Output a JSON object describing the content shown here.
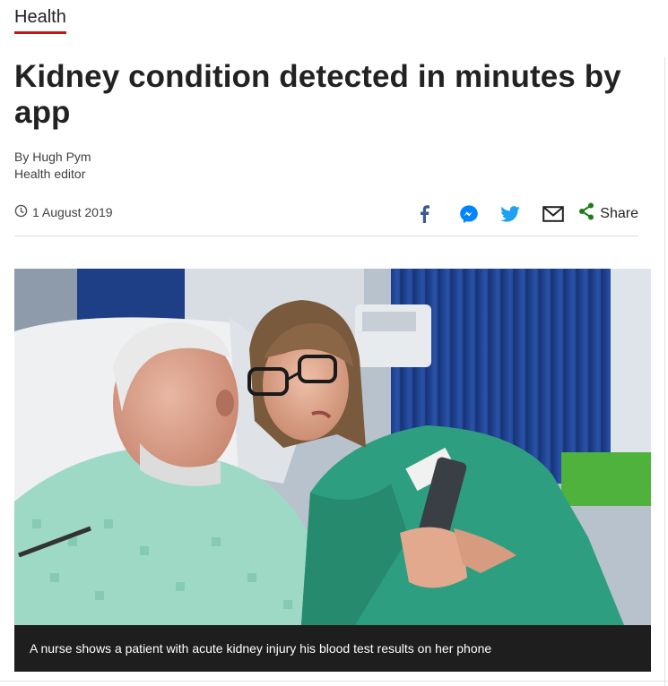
{
  "section": {
    "label": "Health"
  },
  "headline": "Kidney condition detected in minutes by app",
  "byline": {
    "author": "By Hugh Pym",
    "role": "Health editor"
  },
  "date": "1 August 2019",
  "share": {
    "icons": [
      "facebook-icon",
      "messenger-icon",
      "twitter-icon",
      "email-icon",
      "share-icon"
    ],
    "label": "Share"
  },
  "figure": {
    "caption": "A nurse shows a patient with acute kidney injury his blood test results on her phone"
  },
  "colors": {
    "accent": "#bb1919",
    "facebook": "#3b5998",
    "messenger": "#0084ff",
    "twitter": "#1da1f2",
    "email": "#222222",
    "share": "#1a7c1a",
    "caption_bg": "#1e1e1e"
  }
}
